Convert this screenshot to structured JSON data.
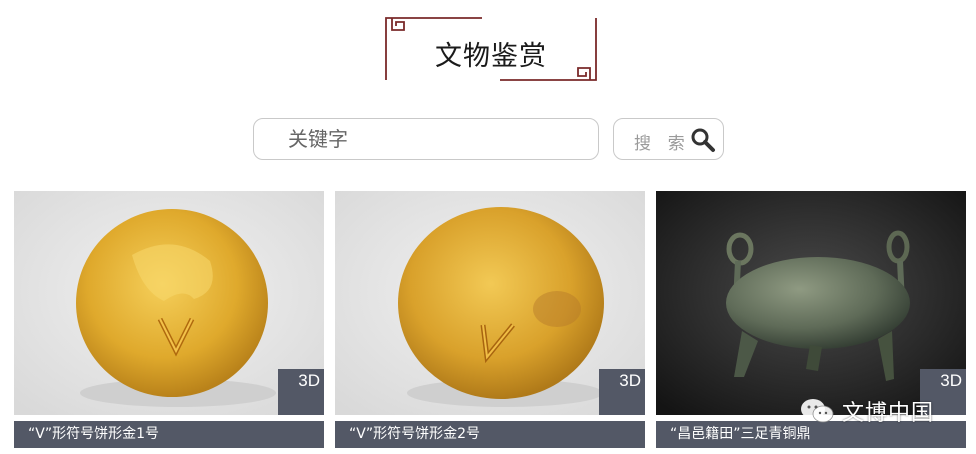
{
  "header": {
    "title": "文物鉴赏"
  },
  "search": {
    "placeholder": "关键字",
    "value": "",
    "button_label": "搜 索"
  },
  "cards": [
    {
      "title": "“V”形符号饼形金1号",
      "badge": "3D"
    },
    {
      "title": "“V”形符号饼形金2号",
      "badge": "3D"
    },
    {
      "title": "“昌邑籍田”三足青铜鼎",
      "badge": "3D"
    }
  ],
  "watermark": {
    "text": "文博中国"
  },
  "colors": {
    "frame": "#7a2a2a",
    "caption_bg": "#535866",
    "badge_bg": "#535866"
  }
}
